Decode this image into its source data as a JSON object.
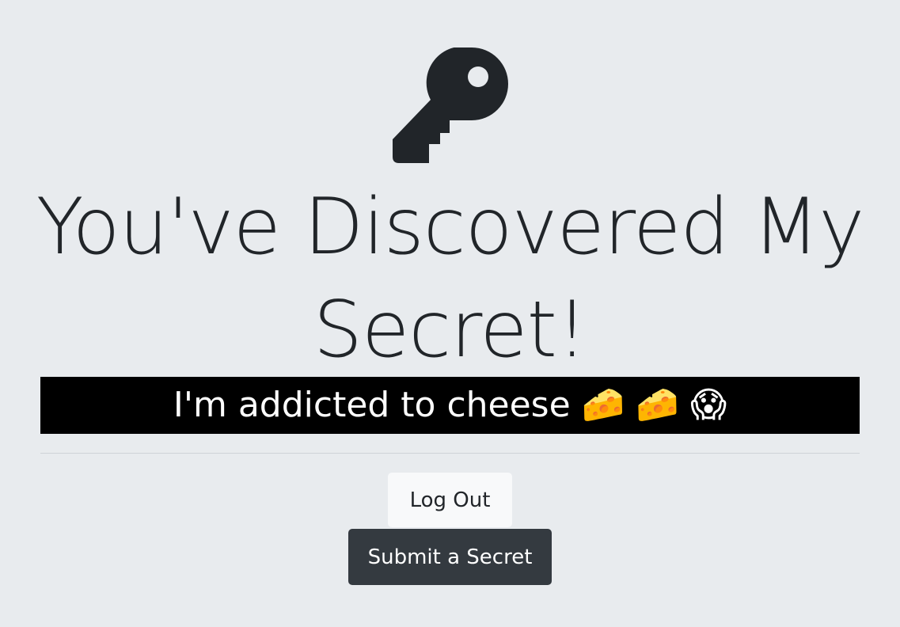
{
  "page": {
    "icon": "key-icon",
    "title": "You've Discovered My Secret!",
    "secret_text": "I'm addicted to cheese 🧀 🧀 😱"
  },
  "buttons": {
    "logout_label": "Log Out",
    "submit_label": "Submit a Secret"
  },
  "colors": {
    "background": "#e8ebee",
    "banner_background": "#000000",
    "banner_text": "#ffffff",
    "light_button": "#f8f9fa",
    "dark_button": "#343a40",
    "icon": "#212529"
  }
}
